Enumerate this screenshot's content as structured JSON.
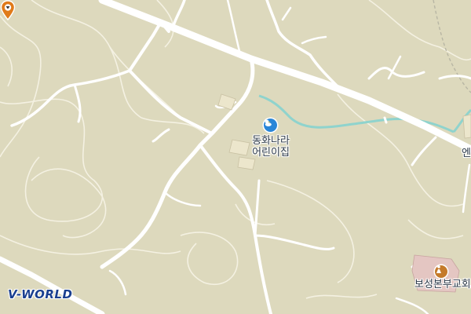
{
  "map": {
    "background": "#ddd9bd",
    "road_color": "#ffffff",
    "stream_color": "#8fd3cd",
    "contour_color": "#f4f1e2"
  },
  "pois": {
    "daycare": {
      "label_line1": "동화나라",
      "label_line2": "어린이집",
      "icon": "daycare-icon"
    },
    "church": {
      "label": "보성본부교회",
      "icon": "church-icon"
    },
    "edge_label": "엔"
  },
  "marker": {
    "icon": "location-pin-icon",
    "color": "#e07b1a"
  },
  "logo": {
    "text": "V-WORLD"
  }
}
